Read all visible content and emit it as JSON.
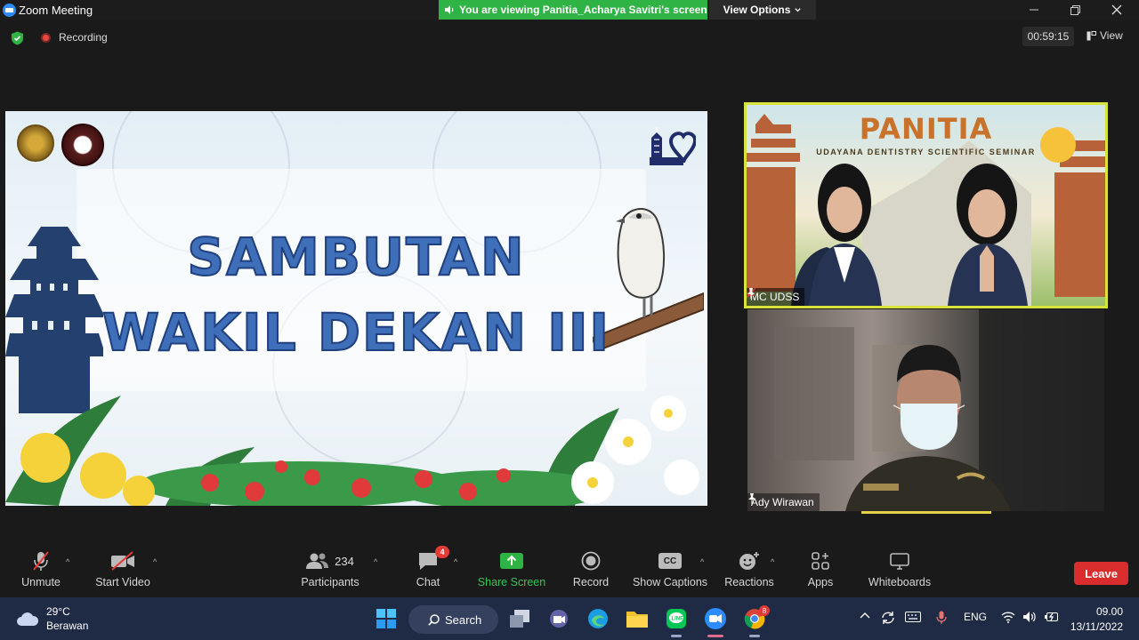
{
  "window": {
    "title": "Zoom Meeting",
    "banner_text": "You are viewing Panitia_Acharya Savitri's screen",
    "view_options_label": "View Options",
    "controls": [
      "minimize",
      "restore",
      "close"
    ]
  },
  "meeting_bar": {
    "recording_label": "Recording",
    "elapsed_time": "00:59:15",
    "view_label": "View"
  },
  "shared_screen": {
    "title_line1": "SAMBUTAN",
    "title_line2": "WAKIL DEKAN III"
  },
  "participants_tiles": [
    {
      "name": "MC UDSS",
      "slide_title": "PANITIA",
      "slide_subtitle": "UDAYANA DENTISTRY SCIENTIFIC SEMINAR",
      "muted": true,
      "pinned": true
    },
    {
      "name": "Ady Wirawan",
      "pinned": true,
      "active_speaker": true
    }
  ],
  "toolbar": {
    "unmute_label": "Unmute",
    "start_video_label": "Start Video",
    "participants_label": "Participants",
    "participants_count": "234",
    "chat_label": "Chat",
    "chat_badge": "4",
    "share_screen_label": "Share Screen",
    "record_label": "Record",
    "captions_label": "Show Captions",
    "captions_icon_text": "CC",
    "reactions_label": "Reactions",
    "apps_label": "Apps",
    "whiteboards_label": "Whiteboards",
    "leave_label": "Leave"
  },
  "taskbar": {
    "weather_temp": "29°C",
    "weather_desc": "Berawan",
    "search_label": "Search",
    "language": "ENG",
    "time": "09.00",
    "date": "13/11/2022",
    "apps": [
      "windows-start",
      "search",
      "file-explorer-tray",
      "teams",
      "edge",
      "file-explorer",
      "line",
      "zoom",
      "chrome"
    ],
    "chrome_badge": "8"
  },
  "colors": {
    "banner_green": "#2fb344",
    "leave_red": "#d92d2d",
    "active_tile_border": "#d8e23b",
    "slide_title_blue": "#3f6fb8",
    "share_screen_green": "#34c55a",
    "taskbar_bg": "#1f2a44"
  }
}
